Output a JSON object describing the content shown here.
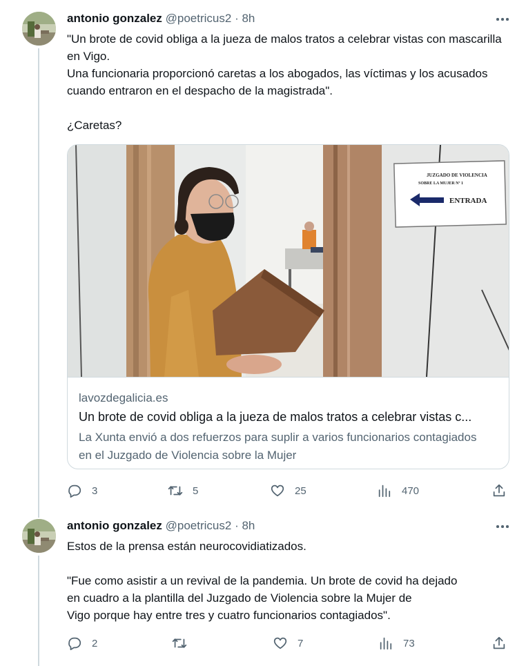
{
  "tweets": [
    {
      "author_name": "antonio gonzalez",
      "author_handle": "@poetricus2",
      "time": "· 8h",
      "text": "\"Un brote de covid obliga a la jueza de malos tratos a celebrar vistas con mascarilla en Vigo.\nUna funcionaria proporcionó caretas a los abogados, las víctimas y los acusados cuando entraron en el despacho de la magistrada\".\n\n¿Caretas?",
      "card": {
        "sign_line1": "JUZGADO DE VIOLENCIA",
        "sign_line2": "SOBRE LA MUJER Nº 1",
        "sign_entry": "ENTRADA",
        "domain": "lavozdegalicia.es",
        "title": "Un brote de covid obliga a la jueza de malos tratos a celebrar vistas c...",
        "description": "La Xunta envió a dos refuerzos para suplir a varios funcionarios contagiados en el Juzgado de Violencia sobre la Mujer"
      },
      "replies": "3",
      "retweets": "5",
      "likes": "25",
      "views": "470"
    },
    {
      "author_name": "antonio gonzalez",
      "author_handle": "@poetricus2",
      "time": "· 8h",
      "text": "Estos de la prensa están neurocovidiatizados.\n\n\"Fue como asistir a un revival de la pandemia. Un brote de covid ha dejado\nen cuadro a la plantilla del Juzgado de Violencia sobre la Mujer de\nVigo porque hay entre tres y cuatro funcionarios contagiados\".",
      "replies": "2",
      "retweets": "",
      "likes": "7",
      "views": "73"
    }
  ],
  "icons": {
    "reply": "reply-icon",
    "retweet": "retweet-icon",
    "like": "like-icon",
    "views": "views-icon",
    "share": "share-icon",
    "more": "more-icon"
  },
  "colors": {
    "text": "#0f1419",
    "secondary": "#536471",
    "border": "#cfd9de"
  }
}
